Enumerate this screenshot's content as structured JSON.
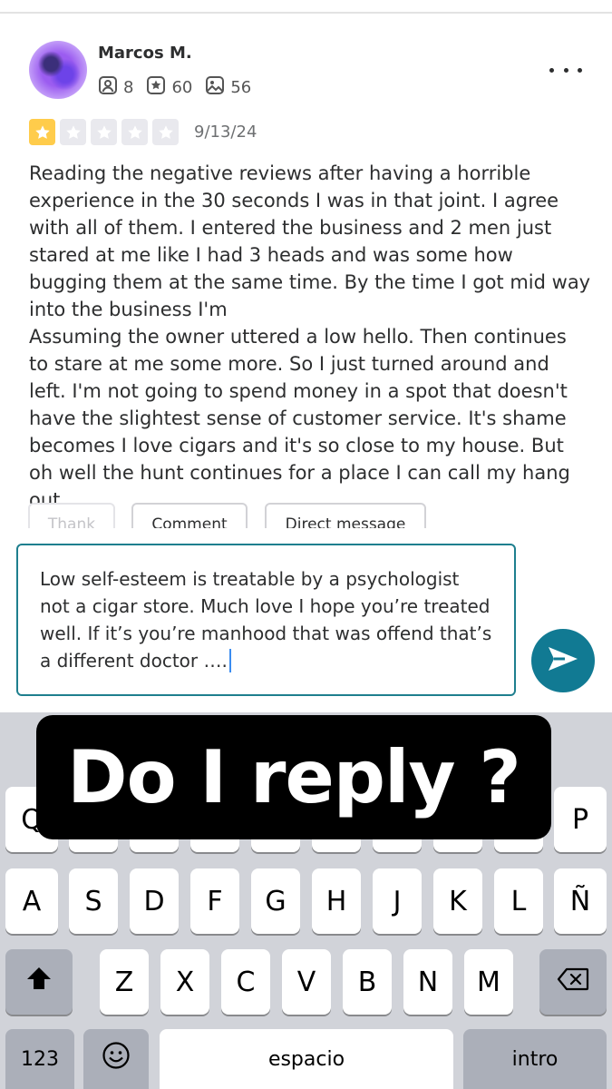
{
  "review": {
    "reviewer_name": "Marcos M.",
    "stats": {
      "friends": "8",
      "reviews": "60",
      "photos": "56"
    },
    "rating": 1,
    "date": "9/13/24",
    "text": "Reading the negative reviews after having a horrible experience in the 30 seconds I was in that joint. I agree with all of them. I entered the business and 2 men just stared at me like I had 3 heads and was some how bugging them at the same time. By the time I got mid way into the business I'm\nAssuming the owner uttered a low hello. Then continues to stare at me some more. So I just turned around and left. I'm not going to spend money in a spot that doesn't have the slightest sense of customer service. It's shame becomes I love cigars and it's so close to my house. But oh well the hunt continues for a place I can call my hang out."
  },
  "actions": {
    "thank": "Thank",
    "comment": "Comment",
    "direct_message": "Direct message"
  },
  "comment_box": {
    "value": "Low self-esteem is treatable by a psychologist not a cigar store. Much love I hope you’re treated well. If it’s you’re manhood that was offend that’s a different doctor …."
  },
  "overlay": {
    "caption": "Do I reply ?"
  },
  "keyboard": {
    "row1": [
      "Q",
      "P"
    ],
    "row2": [
      "A",
      "S",
      "D",
      "F",
      "G",
      "H",
      "J",
      "K",
      "L",
      "Ñ"
    ],
    "row3": [
      "Z",
      "X",
      "C",
      "V",
      "B",
      "N",
      "M"
    ],
    "numbers": "123",
    "space": "espacio",
    "return": "intro"
  },
  "colors": {
    "accent": "#1e7f8e",
    "send": "#117a93",
    "star": "#ffcc4b"
  }
}
